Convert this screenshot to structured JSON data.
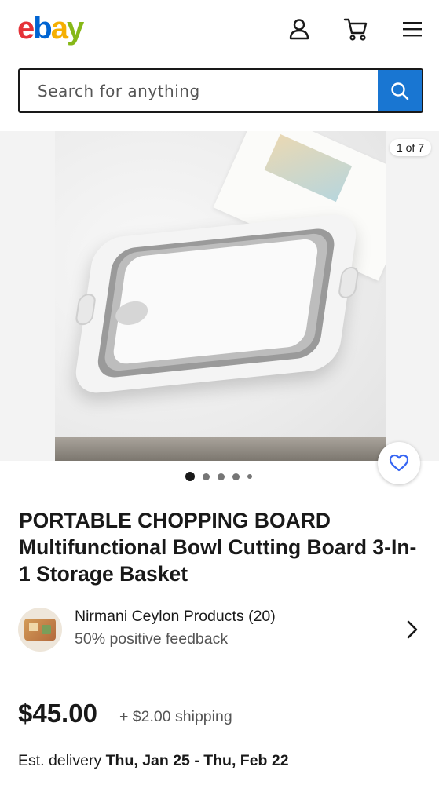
{
  "header": {
    "logo_letters": [
      "e",
      "b",
      "a",
      "y"
    ],
    "logo_colors": [
      "#e53238",
      "#0064d2",
      "#f5af02",
      "#86b817"
    ],
    "icons": [
      "user-icon",
      "cart-icon",
      "menu-icon"
    ]
  },
  "search": {
    "placeholder": "Search for anything",
    "button_icon": "search-icon",
    "button_color": "#1976d2"
  },
  "gallery": {
    "counter": "1 of 7",
    "current_image": 1,
    "total_images": 7,
    "visible_dots": 5,
    "favorite_icon": "heart-icon"
  },
  "product": {
    "title": "PORTABLE CHOPPING BOARD Multifunctional Bowl Cutting Board 3-In-1 Storage Basket"
  },
  "seller": {
    "name": "Nirmani Ceylon Products (20)",
    "feedback": "50% positive feedback"
  },
  "pricing": {
    "price": "$45.00",
    "shipping": "+ $2.00 shipping"
  },
  "delivery": {
    "label": "Est. delivery",
    "dates": "Thu, Jan 25 - Thu, Feb 22"
  }
}
